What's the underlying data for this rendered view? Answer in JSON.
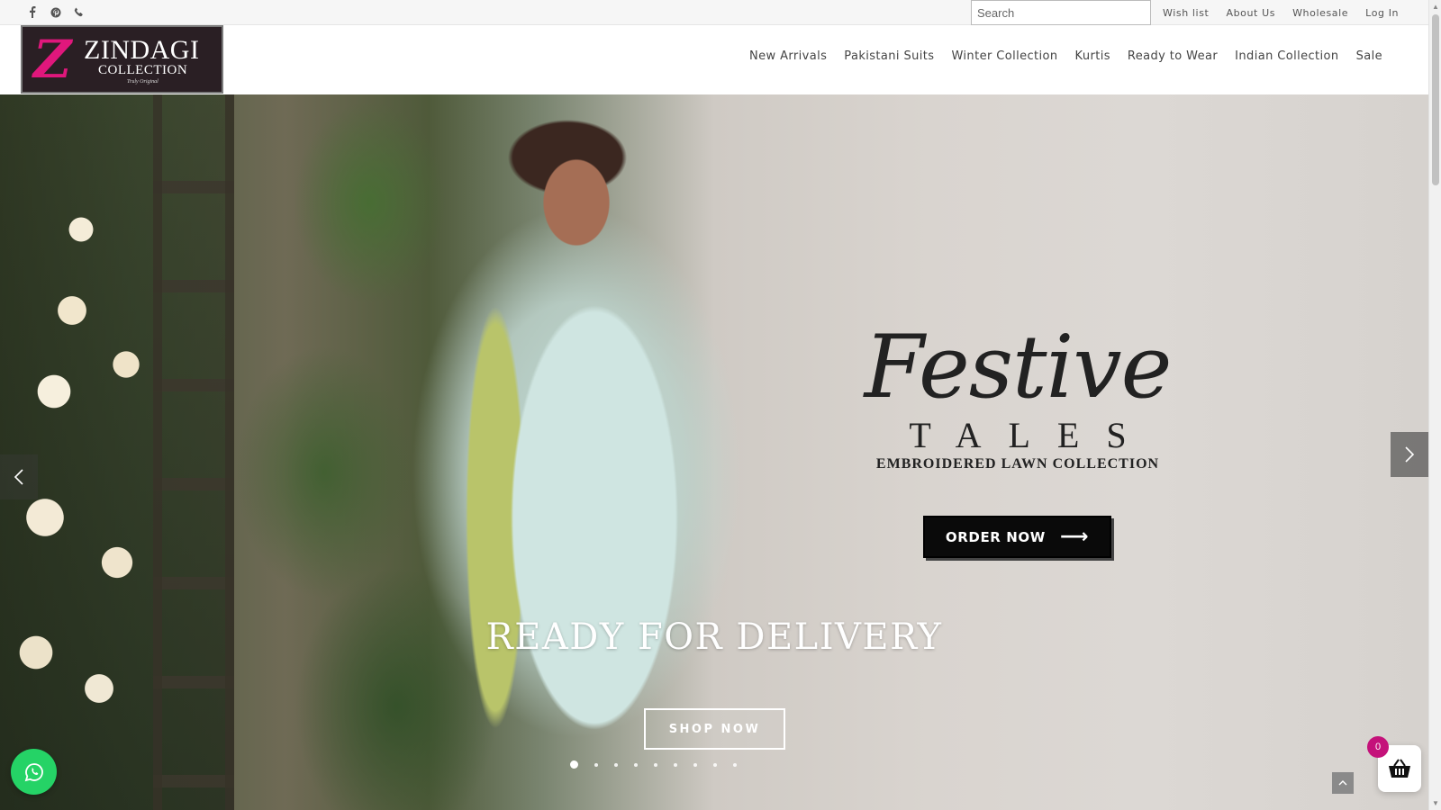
{
  "topbar": {
    "social_icons": [
      "facebook-icon",
      "pinterest-icon",
      "phone-icon"
    ],
    "search": {
      "placeholder": "Search",
      "value": ""
    },
    "links": [
      "Wish list",
      "About Us",
      "Wholesale",
      "Log In"
    ]
  },
  "header": {
    "logo": {
      "line1": "ZINDAGI",
      "line2": "COLLECTION",
      "tagline": "Truly Original",
      "accent_color": "#e0177c"
    },
    "nav": [
      "New Arrivals",
      "Pakistani Suits",
      "Winter Collection",
      "Kurtis",
      "Ready to Wear",
      "Indian Collection",
      "Sale"
    ]
  },
  "hero": {
    "banner_script": "Festive",
    "banner_title": "TALES",
    "banner_subtitle": "EMBROIDERED LAWN COLLECTION",
    "order_button": "ORDER NOW",
    "headline": "READY FOR DELIVERY",
    "shop_button": "SHOP NOW",
    "slides_total": 9,
    "active_slide": 1
  },
  "floating": {
    "cart_count": "0",
    "whatsapp_color": "#25d366",
    "cart_badge_color": "#c4127a"
  }
}
